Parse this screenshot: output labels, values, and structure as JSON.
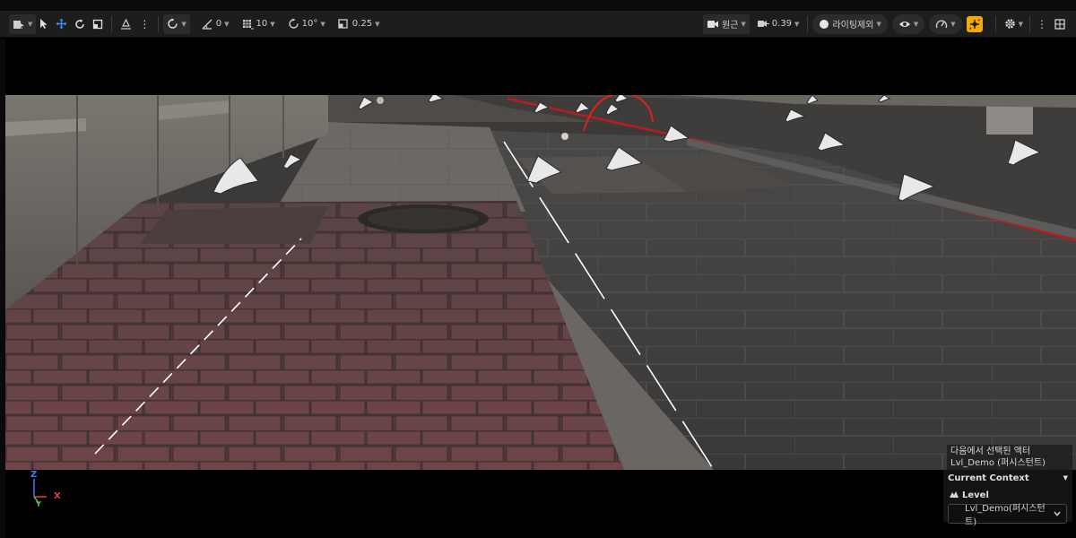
{
  "toolbar": {
    "snap_rotation_value": "0",
    "grid_snap_value": "10",
    "rotation_snap_value": "10°",
    "scale_snap_value": "0.25",
    "camera_label": "원근",
    "camera_speed_value": "0.39",
    "lighting_label": "라이팅제외",
    "accent_color": "#f7a800"
  },
  "viewport": {
    "axis_z": "Z",
    "axis_x": "X",
    "axis_y": "Y"
  },
  "selection": {
    "line1": "다음에서 선택된 액터",
    "line2": "Lvl_Demo (퍼시스턴트)"
  },
  "context": {
    "header": "Current Context",
    "level_label": "Level",
    "level_value": "Lvl_Demo(퍼시스턴트)"
  }
}
